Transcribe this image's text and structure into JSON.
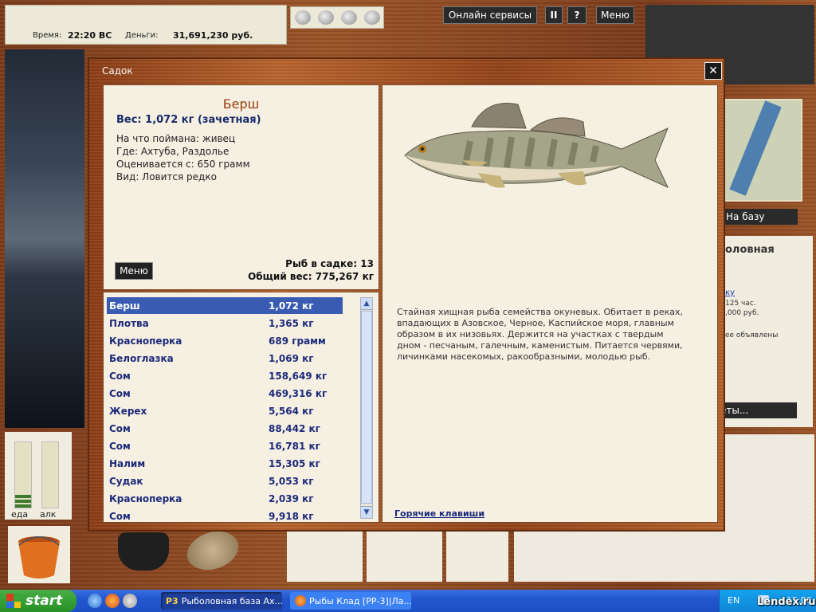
{
  "hud": {
    "time_label": "Время:",
    "time_value": "22:20 ВС",
    "money_label": "Деньги:",
    "money_value": "31,691,230 руб.",
    "online_services": "Онлайн сервисы",
    "pause": "II",
    "help": "?",
    "menu": "Меню"
  },
  "right_side": {
    "to_base": "На базу",
    "info_title": "оловная",
    "info_link": "ку",
    "line1": "125 час.",
    "line2": ",000 руб.",
    "line3": "ее объявлены",
    "quests_btn": "еты..."
  },
  "meters": {
    "eat_label": "еда",
    "alc_label": "алк",
    "eat_level": 0.2,
    "alc_level": 0
  },
  "modal": {
    "title": "Садок",
    "close": "✕",
    "fish": {
      "name": "Берш",
      "weight": "Вес: 1,072 кг (зачетная)",
      "bait": "На что поймана: живец",
      "where": "Где: Ахтуба, Раздолье",
      "valued_from": "Оценивается с: 650 грамм",
      "kind": "Вид: Ловится редко"
    },
    "menu_btn": "Меню",
    "keepnet_count": "Рыб в садке: 13",
    "total_weight": "Общий вес: 775,267 кг",
    "list": [
      {
        "name": "Берш",
        "weight": "1,072 кг"
      },
      {
        "name": "Плотва",
        "weight": "1,365 кг"
      },
      {
        "name": "Красноперка",
        "weight": "689 грамм"
      },
      {
        "name": "Белоглазка",
        "weight": "1,069 кг"
      },
      {
        "name": "Сом",
        "weight": "158,649 кг"
      },
      {
        "name": "Сом",
        "weight": "469,316 кг"
      },
      {
        "name": "Жерех",
        "weight": "5,564 кг"
      },
      {
        "name": "Сом",
        "weight": "88,442 кг"
      },
      {
        "name": "Сом",
        "weight": "16,781 кг"
      },
      {
        "name": "Налим",
        "weight": "15,305 кг"
      },
      {
        "name": "Судак",
        "weight": "5,053 кг"
      },
      {
        "name": "Красноперка",
        "weight": "2,039 кг"
      },
      {
        "name": "Сом",
        "weight": "9,918 кг"
      }
    ],
    "description": "Стайная хищная рыба семейства окуневых. Обитает в реках, впадающих в Азовское, Черное, Каспийское моря, главным образом в их низовьях. Держится на участках с твердым дном - песчаным, галечным, каменистым. Питается червями, личинками насекомых, ракообразными, молодью рыб.",
    "hotkeys": "Горячие клавиши"
  },
  "taskbar": {
    "start": "start",
    "task1": "Рыболовная база Ах...",
    "task2": "Рыбы Клад [РР-3]|Ла...",
    "lang": "EN",
    "clock": "15:06"
  },
  "watermark": "Lendex.ru"
}
